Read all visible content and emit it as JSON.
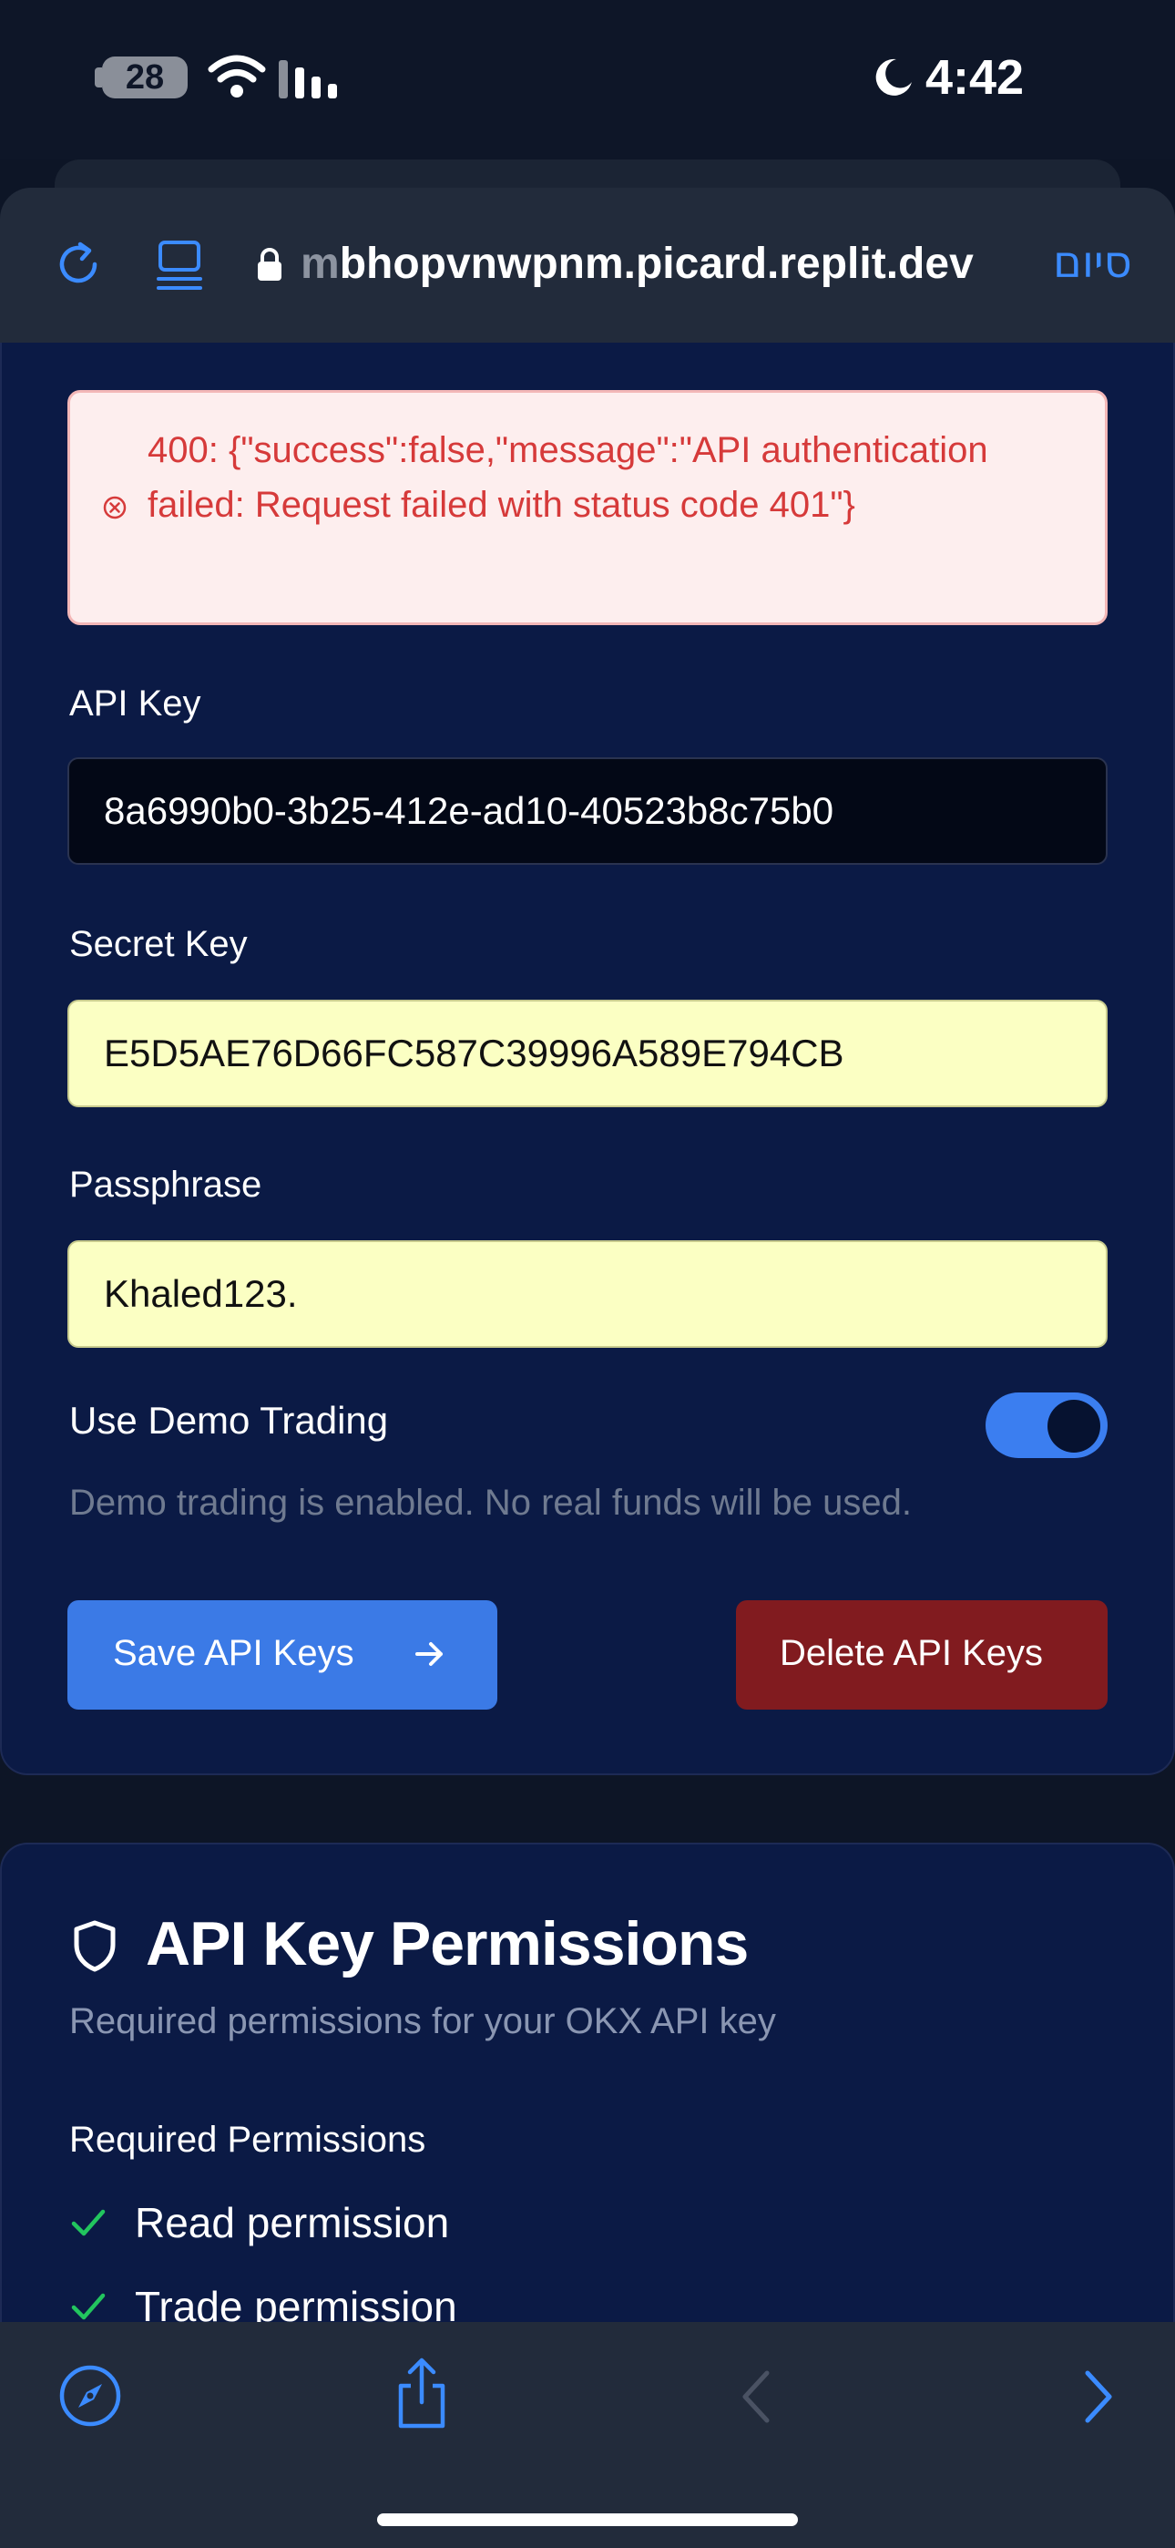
{
  "status_bar": {
    "battery": "28",
    "time": "4:42"
  },
  "browser": {
    "url_fade": "m",
    "url": "bhopvnwpnm.picard.replit.dev",
    "done_label": "סיום"
  },
  "error": {
    "message": "400: {\"success\":false,\"message\":\"API authentication failed: Request failed with status code 401\"}"
  },
  "form": {
    "api_key_label": "API Key",
    "api_key_value": "8a6990b0-3b25-412e-ad10-40523b8c75b0",
    "secret_key_label": "Secret Key",
    "secret_key_value": "E5D5AE76D66FC587C39996A589E794CB",
    "passphrase_label": "Passphrase",
    "passphrase_value": "Khaled123.",
    "demo_label": "Use Demo Trading",
    "demo_enabled": true,
    "demo_help": "Demo trading is enabled. No real funds will be used.",
    "save_label": "Save API Keys",
    "delete_label": "Delete API Keys"
  },
  "permissions": {
    "title": "API Key Permissions",
    "subtitle": "Required permissions for your OKX API key",
    "section_title": "Required Permissions",
    "items": [
      "Read permission",
      "Trade permission"
    ]
  },
  "colors": {
    "accent": "#3b7ae6",
    "danger": "#811b1f",
    "error_text": "#d63a3a",
    "card_bg": "#0b1a45"
  },
  "icons": [
    "reload-icon",
    "reader-icon",
    "lock-icon",
    "error-circle-icon",
    "arrow-right-icon",
    "shield-icon",
    "check-icon",
    "compass-icon",
    "share-icon",
    "back-icon",
    "forward-icon"
  ]
}
